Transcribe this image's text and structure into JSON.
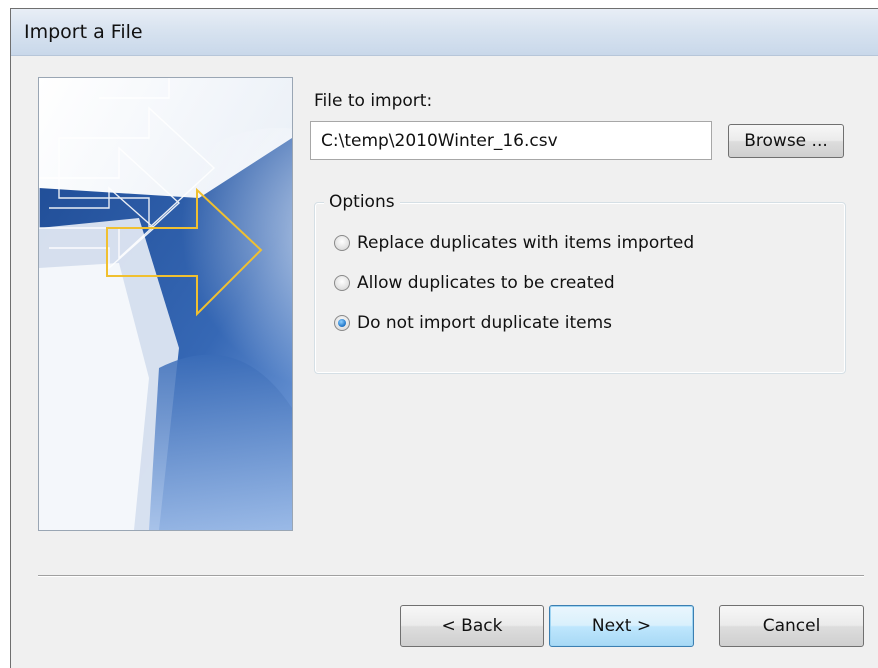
{
  "window": {
    "title": "Import a File"
  },
  "file": {
    "label": "File to import:",
    "value": "C:\\temp\\2010Winter_16.csv",
    "browse_label": "Browse ..."
  },
  "options": {
    "legend": "Options",
    "items": [
      {
        "label": "Replace duplicates with items imported",
        "checked": false
      },
      {
        "label": "Allow duplicates to be created",
        "checked": false
      },
      {
        "label": "Do not import duplicate items",
        "checked": true
      }
    ]
  },
  "buttons": {
    "back": "< Back",
    "next": "Next >",
    "cancel": "Cancel"
  },
  "colors": {
    "accent_arrow": "#f0c030",
    "panel_blue": "#2e5fa8",
    "default_button": "#3c7fb1"
  }
}
